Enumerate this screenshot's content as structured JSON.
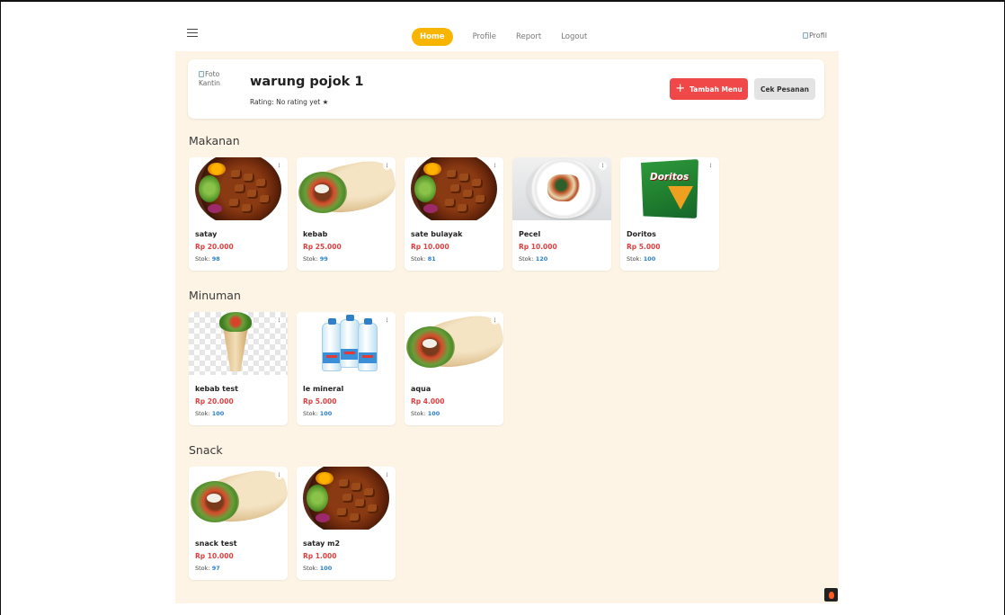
{
  "nav": {
    "items": [
      {
        "label": "Home",
        "active": true
      },
      {
        "label": "Profile",
        "active": false
      },
      {
        "label": "Report",
        "active": false
      },
      {
        "label": "Logout",
        "active": false
      }
    ],
    "profile_alt": "Profil"
  },
  "header": {
    "photo_alt": "Foto Kantin",
    "shop_name": "warung pojok 1",
    "rating": "Rating: No rating yet ★",
    "add_menu_label": "Tambah Menu",
    "check_orders_label": "Cek Pesanan"
  },
  "sections": [
    {
      "title": "Makanan",
      "items": [
        {
          "name": "satay",
          "price": "Rp 20.000",
          "stock_label": "Stok:",
          "stock": "98",
          "image": "satay"
        },
        {
          "name": "kebab",
          "price": "Rp 25.000",
          "stock_label": "Stok:",
          "stock": "99",
          "image": "kebab"
        },
        {
          "name": "sate bulayak",
          "price": "Rp 10.000",
          "stock_label": "Stok:",
          "stock": "81",
          "image": "satay"
        },
        {
          "name": "Pecel",
          "price": "Rp 10.000",
          "stock_label": "Stok:",
          "stock": "120",
          "image": "pecel"
        },
        {
          "name": "Doritos",
          "price": "Rp 5.000",
          "stock_label": "Stok:",
          "stock": "100",
          "image": "doritos",
          "brand_text": "Doritos"
        }
      ]
    },
    {
      "title": "Minuman",
      "items": [
        {
          "name": "kebab test",
          "price": "Rp 20.000",
          "stock_label": "Stok:",
          "stock": "100",
          "image": "wrap-transparent"
        },
        {
          "name": "le mineral",
          "price": "Rp 5.000",
          "stock_label": "Stok:",
          "stock": "100",
          "image": "water-bottles"
        },
        {
          "name": "aqua",
          "price": "Rp 4.000",
          "stock_label": "Stok:",
          "stock": "100",
          "image": "kebab"
        }
      ]
    },
    {
      "title": "Snack",
      "items": [
        {
          "name": "snack test",
          "price": "Rp 10.000",
          "stock_label": "Stok:",
          "stock": "97",
          "image": "kebab"
        },
        {
          "name": "satay m2",
          "price": "Rp 1.000",
          "stock_label": "Stok:",
          "stock": "100",
          "image": "satay"
        }
      ]
    }
  ],
  "colors": {
    "accent_yellow": "#f7b500",
    "primary_red": "#f04848",
    "price_red": "#e04040",
    "stock_blue": "#2a7fcf",
    "content_bg": "#fdf4e5"
  },
  "icons": [
    "hamburger-menu-icon",
    "broken-image-icon",
    "plus-icon",
    "more-options-icon",
    "flame-icon"
  ]
}
